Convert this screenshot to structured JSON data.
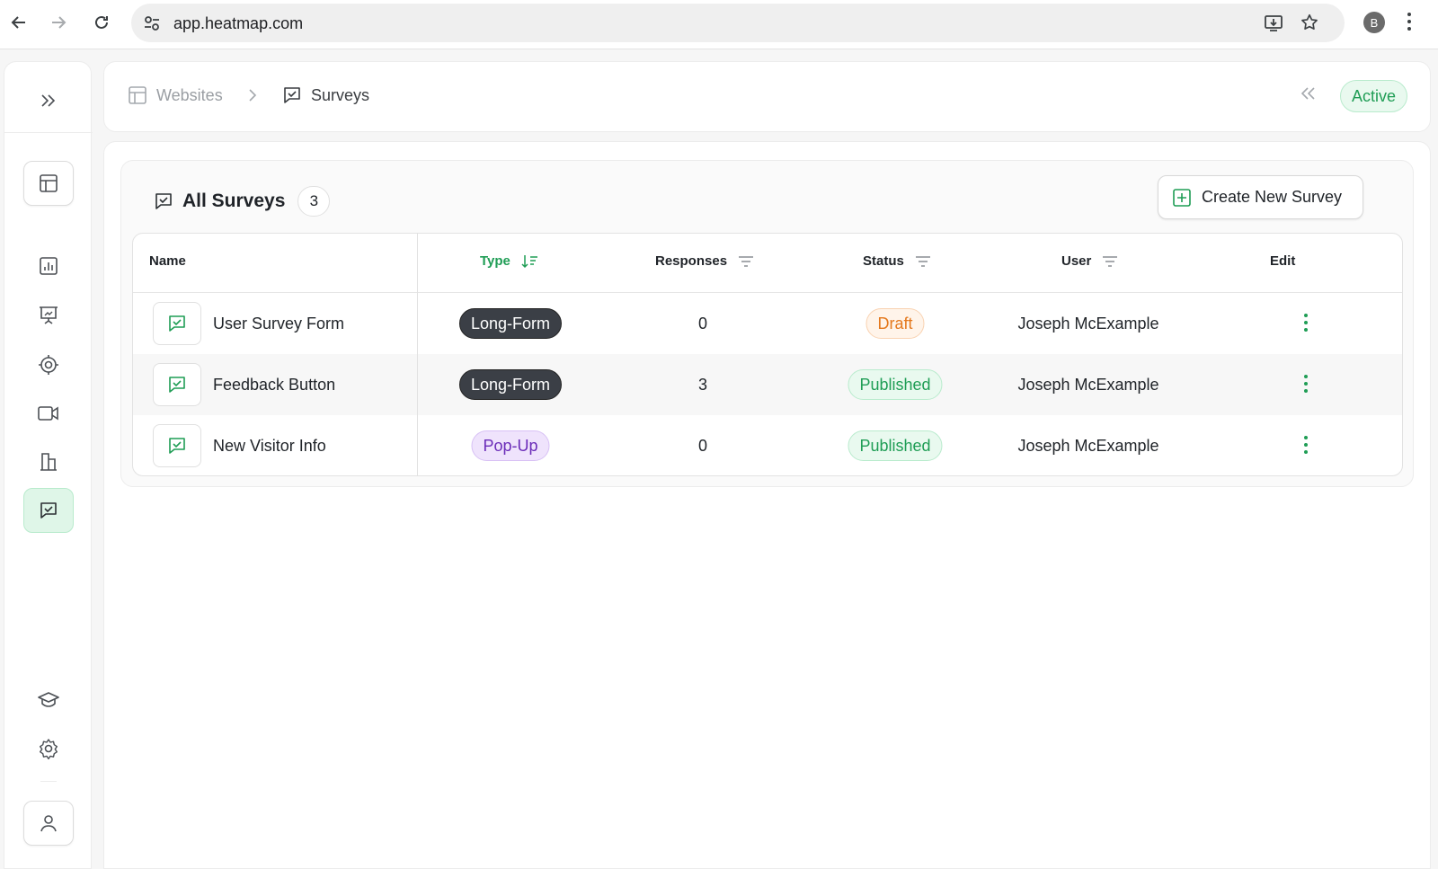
{
  "browser": {
    "url": "app.heatmap.com",
    "profile_initial": "B"
  },
  "breadcrumb": {
    "parent": "Websites",
    "current": "Surveys"
  },
  "header": {
    "status_badge": "Active"
  },
  "panel": {
    "title": "All Surveys",
    "count": "3",
    "create_button": "Create New Survey"
  },
  "table": {
    "columns": {
      "name": "Name",
      "type": "Type",
      "responses": "Responses",
      "status": "Status",
      "user": "User",
      "edit": "Edit"
    },
    "rows": [
      {
        "name": "User Survey Form",
        "type": "Long-Form",
        "responses": "0",
        "status": "Draft",
        "user": "Joseph McExample"
      },
      {
        "name": "Feedback Button",
        "type": "Long-Form",
        "responses": "3",
        "status": "Published",
        "user": "Joseph McExample"
      },
      {
        "name": "New Visitor Info",
        "type": "Pop-Up",
        "responses": "0",
        "status": "Published",
        "user": "Joseph McExample"
      }
    ]
  },
  "colors": {
    "accent_green": "#1f9d55",
    "draft_orange": "#e4781c",
    "popup_purple": "#6a2bb8",
    "dark_pill": "#3b3f46"
  },
  "icons": {
    "rail": [
      "layout-icon",
      "report-icon",
      "presentation-icon",
      "target-icon",
      "video-icon",
      "buildings-icon",
      "survey-icon",
      "graduation-cap-icon",
      "gear-icon",
      "user-icon"
    ]
  }
}
